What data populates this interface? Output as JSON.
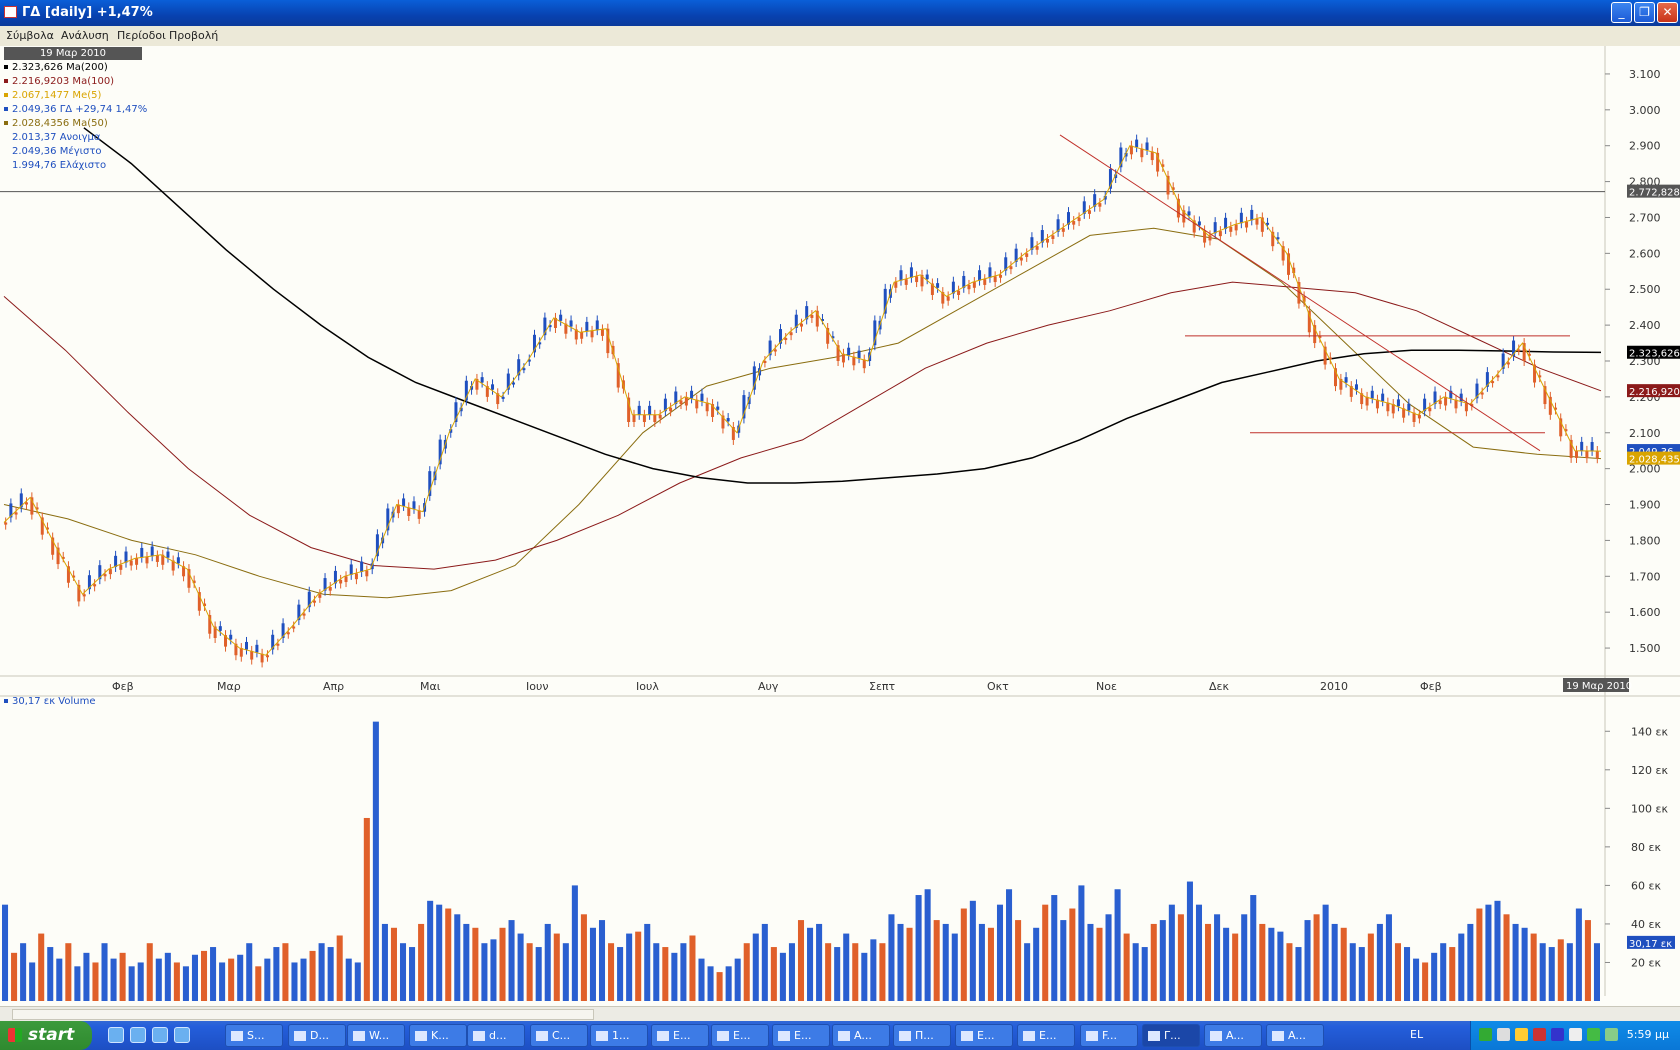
{
  "window": {
    "title": "ΓΔ [daily] +1,47%",
    "buttons": [
      "_",
      "❐",
      "✕"
    ]
  },
  "menu": [
    "Σύμβολα",
    "Ανάλυση",
    "Περίοδοι",
    "Προβολή"
  ],
  "toolbar": {
    "symbol_value": "",
    "tools": [
      "pointer-icon",
      "crosshair-icon",
      "rectangle-icon",
      "line-icon",
      "bars-icon",
      "chart-icon",
      "save-icon"
    ]
  },
  "legend": {
    "date": "19 Μαρ 2010",
    "items": [
      {
        "text": "2.323,626 Ma(200)",
        "color": "#000000"
      },
      {
        "text": "2.216,9203 Ma(100)",
        "color": "#8b1a1a"
      },
      {
        "text": "2.067,1477 Me(5)",
        "color": "#d9a400"
      },
      {
        "text": "2.049,36 ΓΔ +29,74 1,47%",
        "color": "#1f4fbf"
      },
      {
        "text": "2.028,4356 Ma(50)",
        "color": "#8a6d10"
      },
      {
        "text": "2.013,37 Ανοιγμα",
        "color": "#1f4fbf"
      },
      {
        "text": "2.049,36 Μέγιστο",
        "color": "#1f4fbf"
      },
      {
        "text": "1.994,76 Ελάχιστο",
        "color": "#1f4fbf"
      }
    ]
  },
  "chart_data": [
    {
      "type": "line",
      "title": "ΓΔ [daily]",
      "ylim": [
        1450,
        3150
      ],
      "y_ticks": [
        "1.500",
        "1.600",
        "1.700",
        "1.800",
        "1.900",
        "2.000",
        "2.100",
        "2.200",
        "2.300",
        "2.400",
        "2.500",
        "2.600",
        "2.700",
        "2.800",
        "2.900",
        "3.000",
        "3.100"
      ],
      "x_ticks": [
        "Φεβ",
        "Μαρ",
        "Απρ",
        "Μαι",
        "Ιουν",
        "Ιουλ",
        "Αυγ",
        "Σεπτ",
        "Οκτ",
        "Νοε",
        "Δεκ",
        "2010",
        "Φεβ"
      ],
      "x_end_label": "19 Μαρ 2010",
      "x": [
        "2009-01-19",
        "2009-01-26",
        "2009-02-02",
        "2009-02-09",
        "2009-02-16",
        "2009-02-23",
        "2009-03-02",
        "2009-03-09",
        "2009-03-16",
        "2009-03-23",
        "2009-03-30",
        "2009-04-06",
        "2009-04-13",
        "2009-04-20",
        "2009-04-27",
        "2009-05-04",
        "2009-05-11",
        "2009-05-18",
        "2009-05-25",
        "2009-06-01",
        "2009-06-08",
        "2009-06-15",
        "2009-06-22",
        "2009-06-29",
        "2009-07-06",
        "2009-07-13",
        "2009-07-20",
        "2009-07-27",
        "2009-08-03",
        "2009-08-10",
        "2009-08-17",
        "2009-08-24",
        "2009-08-31",
        "2009-09-07",
        "2009-09-14",
        "2009-09-21",
        "2009-09-28",
        "2009-10-05",
        "2009-10-12",
        "2009-10-19",
        "2009-10-26",
        "2009-11-02",
        "2009-11-09",
        "2009-11-16",
        "2009-11-23",
        "2009-11-30",
        "2009-12-07",
        "2009-12-14",
        "2009-12-21",
        "2009-12-28",
        "2010-01-04",
        "2010-01-11",
        "2010-01-18",
        "2010-01-25",
        "2010-02-01",
        "2010-02-08",
        "2010-02-15",
        "2010-02-22",
        "2010-03-01",
        "2010-03-08",
        "2010-03-15",
        "2010-03-19"
      ],
      "series": [
        {
          "name": "ΓΔ",
          "color": "#1f4fbf",
          "values": [
            1850,
            1920,
            1780,
            1650,
            1720,
            1750,
            1760,
            1720,
            1560,
            1500,
            1480,
            1560,
            1650,
            1700,
            1720,
            1900,
            1880,
            2100,
            2250,
            2200,
            2300,
            2420,
            2380,
            2390,
            2150,
            2150,
            2200,
            2180,
            2100,
            2300,
            2380,
            2440,
            2320,
            2300,
            2520,
            2540,
            2480,
            2520,
            2540,
            2600,
            2650,
            2700,
            2750,
            2900,
            2880,
            2720,
            2650,
            2680,
            2700,
            2600,
            2400,
            2250,
            2200,
            2180,
            2150,
            2200,
            2180,
            2260,
            2350,
            2200,
            2050,
            2049
          ]
        },
        {
          "name": "Ma(200)",
          "color": "#000000",
          "values": [
            2950,
            2850,
            2730,
            2610,
            2500,
            2400,
            2310,
            2240,
            2190,
            2140,
            2090,
            2040,
            2000,
            1975,
            1960,
            1960,
            1965,
            1975,
            1985,
            2000,
            2030,
            2080,
            2140,
            2190,
            2240,
            2270,
            2300,
            2320,
            2330,
            2330,
            2328,
            2325,
            2324
          ]
        },
        {
          "name": "Ma(100)",
          "color": "#8b1a1a",
          "values": [
            2480,
            2330,
            2160,
            2000,
            1870,
            1780,
            1730,
            1720,
            1745,
            1800,
            1870,
            1960,
            2030,
            2080,
            2180,
            2280,
            2350,
            2400,
            2440,
            2490,
            2520,
            2505,
            2490,
            2440,
            2360,
            2280,
            2217
          ]
        },
        {
          "name": "Ma(50)",
          "color": "#8a6d10",
          "values": [
            1900,
            1860,
            1800,
            1760,
            1700,
            1650,
            1640,
            1660,
            1730,
            1900,
            2100,
            2230,
            2280,
            2310,
            2350,
            2450,
            2550,
            2650,
            2670,
            2640,
            2520,
            2350,
            2180,
            2060,
            2040,
            2028
          ]
        }
      ],
      "horizontal_lines": [
        {
          "price_label": "2.772,828",
          "color": "#555555"
        },
        {
          "price_label": "2.323,626",
          "color": "#000000"
        },
        {
          "price_label": "2.216,920",
          "color": "#8b1a1a"
        },
        {
          "price_label": "2.049,36",
          "color": "#1f4fbf"
        },
        {
          "price_label": "2.028,435",
          "color": "#d9a400"
        }
      ]
    },
    {
      "type": "bar",
      "title": "30,17 εκ Volume",
      "ylim": [
        0,
        150
      ],
      "y_ticks": [
        "20 εκ",
        "40 εκ",
        "60 εκ",
        "80 εκ",
        "100 εκ",
        "120 εκ",
        "140 εκ"
      ],
      "last_value_label": "30,17 εκ",
      "values": [
        50,
        25,
        30,
        20,
        35,
        28,
        22,
        30,
        18,
        25,
        20,
        30,
        22,
        25,
        18,
        20,
        30,
        22,
        25,
        20,
        18,
        24,
        26,
        28,
        20,
        22,
        24,
        30,
        18,
        22,
        28,
        30,
        20,
        22,
        26,
        30,
        28,
        34,
        22,
        20,
        95,
        145,
        40,
        38,
        30,
        28,
        40,
        52,
        50,
        48,
        45,
        40,
        38,
        30,
        32,
        38,
        42,
        35,
        30,
        28,
        40,
        35,
        30,
        60,
        45,
        38,
        42,
        30,
        28,
        35,
        36,
        40,
        30,
        28,
        25,
        30,
        34,
        22,
        18,
        15,
        18,
        22,
        30,
        35,
        40,
        28,
        25,
        30,
        42,
        38,
        40,
        30,
        28,
        35,
        30,
        25,
        32,
        30,
        45,
        40,
        38,
        55,
        58,
        42,
        40,
        35,
        48,
        52,
        40,
        38,
        50,
        58,
        42,
        30,
        38,
        50,
        55,
        42,
        48,
        60,
        40,
        38,
        45,
        58,
        35,
        30,
        28,
        40,
        42,
        50,
        45,
        62,
        50,
        40,
        45,
        38,
        35,
        45,
        55,
        40,
        38,
        36,
        30,
        28,
        42,
        45,
        50,
        40,
        38,
        30,
        28,
        35,
        40,
        45,
        30,
        28,
        22,
        20,
        25,
        30,
        28,
        35,
        40,
        48,
        50,
        52,
        45,
        40,
        38,
        35,
        30,
        28,
        32,
        30,
        48,
        42,
        30
      ]
    }
  ],
  "scrollbar": {
    "position_pct": 35
  },
  "taskbar": {
    "start_label": "start",
    "tasks": [
      {
        "label": "S..."
      },
      {
        "label": "D..."
      },
      {
        "label": "W..."
      },
      {
        "label": "K..."
      },
      {
        "label": "d..."
      },
      {
        "label": "C..."
      },
      {
        "label": "1..."
      },
      {
        "label": "E..."
      },
      {
        "label": "E..."
      },
      {
        "label": "E..."
      },
      {
        "label": "A..."
      },
      {
        "label": "Π..."
      },
      {
        "label": "E..."
      },
      {
        "label": "E..."
      },
      {
        "label": "F..."
      },
      {
        "label": "Γ..."
      },
      {
        "label": "A..."
      },
      {
        "label": "A..."
      }
    ],
    "language": "EL",
    "clock": "5:59 μμ"
  }
}
